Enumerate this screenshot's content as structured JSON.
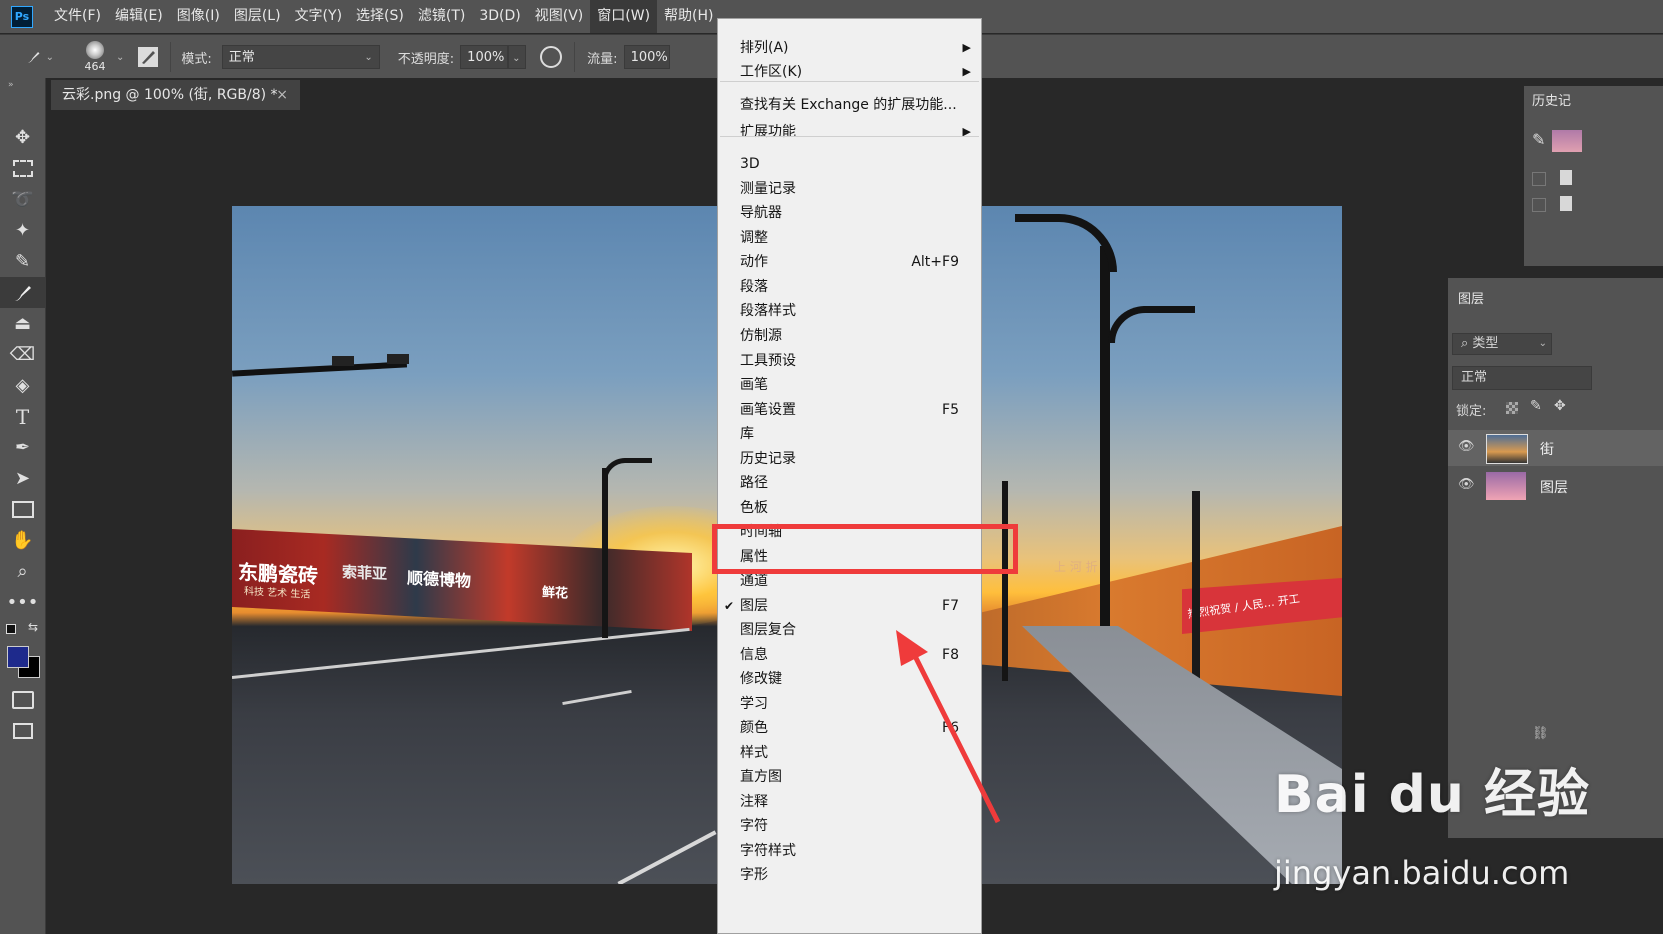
{
  "app": {
    "logo_text": "Ps"
  },
  "menubar": {
    "items": [
      "文件(F)",
      "编辑(E)",
      "图像(I)",
      "图层(L)",
      "文字(Y)",
      "选择(S)",
      "滤镜(T)",
      "3D(D)",
      "视图(V)",
      "窗口(W)",
      "帮助(H)"
    ]
  },
  "options": {
    "brush_size": "464",
    "mode_label": "模式:",
    "mode_value": "正常",
    "opacity_label": "不透明度:",
    "opacity_value": "100%",
    "flow_label": "流量:",
    "flow_value": "100%"
  },
  "document": {
    "tab_title": "云彩.png @ 100% (街, RGB/8) *",
    "close_glyph": "×"
  },
  "window_menu": {
    "items": [
      {
        "label": "排列(A)",
        "submenu": true
      },
      {
        "label": "工作区(K)",
        "submenu": true
      },
      {
        "separator": true
      },
      {
        "label": "查找有关 Exchange 的扩展功能..."
      },
      {
        "label": "扩展功能",
        "submenu": true
      },
      {
        "separator": true
      },
      {
        "label": "3D"
      },
      {
        "label": "测量记录"
      },
      {
        "label": "导航器"
      },
      {
        "label": "调整"
      },
      {
        "label": "动作",
        "shortcut": "Alt+F9"
      },
      {
        "label": "段落"
      },
      {
        "label": "段落样式"
      },
      {
        "label": "仿制源"
      },
      {
        "label": "工具预设"
      },
      {
        "label": "画笔"
      },
      {
        "label": "画笔设置",
        "shortcut": "F5"
      },
      {
        "label": "库"
      },
      {
        "label": "历史记录"
      },
      {
        "label": "路径"
      },
      {
        "label": "色板"
      },
      {
        "label": "时间轴"
      },
      {
        "label": "属性"
      },
      {
        "label": "通道"
      },
      {
        "label": "图层",
        "shortcut": "F7",
        "checked": true
      },
      {
        "label": "图层复合"
      },
      {
        "label": "信息",
        "shortcut": "F8"
      },
      {
        "label": "修改键"
      },
      {
        "label": "学习"
      },
      {
        "label": "颜色",
        "shortcut": "F6"
      },
      {
        "label": "样式"
      },
      {
        "label": "直方图"
      },
      {
        "label": "注释"
      },
      {
        "label": "字符"
      },
      {
        "label": "字符样式"
      },
      {
        "label": "字形"
      }
    ]
  },
  "panels": {
    "history_tab": "历史记",
    "layers_tab": "图层",
    "filter_label": "类型",
    "blend_mode": "正常",
    "lock_label": "锁定:",
    "layers": [
      {
        "name": "街"
      },
      {
        "name": "图层"
      }
    ]
  },
  "photo_texts": {
    "billboard_1": "东鹏瓷砖",
    "billboard_1_sub": "科技 艺术 生活",
    "billboard_2": "索菲亚",
    "billboard_3": "顺德博物",
    "billboard_4": "鲜花",
    "banner": "热烈祝贺 / 人民… 开工",
    "wall_sign": "上 河 折"
  },
  "watermark": {
    "logo_text": "Bai du 经验",
    "url": "jingyan.baidu.com"
  },
  "colors": {
    "annotation_red": "#ef3b3b",
    "foreground_swatch": "#1e2a8c",
    "background_swatch": "#000000"
  }
}
